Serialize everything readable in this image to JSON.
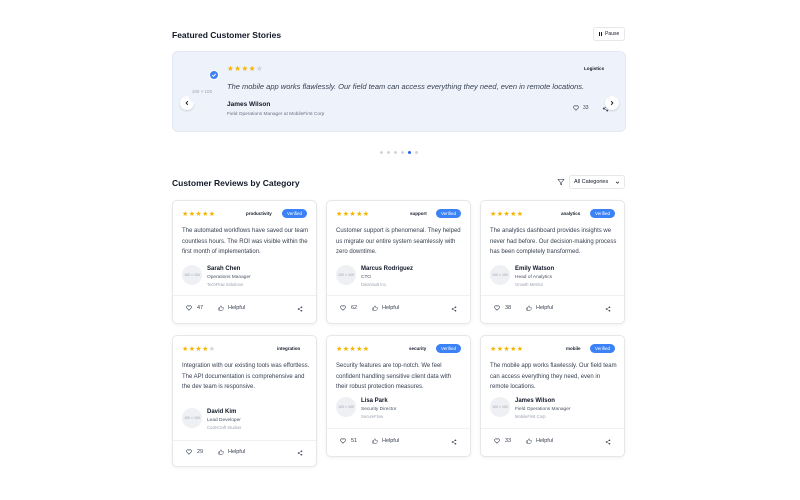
{
  "featured": {
    "section_title": "Featured Customer Stories",
    "pause_label": "Pause",
    "avatar_placeholder": "100 × 100",
    "rating": 4,
    "quote": "The mobile app works flawlessly. Our field team can access everything they need, even in remote locations.",
    "name": "James Wilson",
    "role": "Field Operations Manager at MobileFirst Corp",
    "tag": "Logistics",
    "likes": "33",
    "dots_total": 6,
    "dots_active": 5
  },
  "reviews": {
    "section_title": "Customer Reviews by Category",
    "filter_value": "All Categories",
    "verified_label": "Verified",
    "helpful_label": "Helpful",
    "avatar_placeholder": "100 × 100",
    "colors": {
      "accent": "#3b82f6",
      "star": "#f5b400"
    }
  },
  "cards": [
    {
      "rating": 5,
      "category": "productivity",
      "verified": true,
      "text": "The automated workflows have saved our team countless hours. The ROI was visible within the first month of implementation.",
      "name": "Sarah Chen",
      "role": "Operations Manager",
      "company": "TechFlow Solutions",
      "likes": "47"
    },
    {
      "rating": 5,
      "category": "support",
      "verified": true,
      "text": "Customer support is phenomenal. They helped us migrate our entire system seamlessly with zero downtime.",
      "name": "Marcus Rodriguez",
      "role": "CTO",
      "company": "DataVault Inc.",
      "likes": "62"
    },
    {
      "rating": 5,
      "category": "analytics",
      "verified": true,
      "text": "The analytics dashboard provides insights we never had before. Our decision-making process has been completely transformed.",
      "name": "Emily Watson",
      "role": "Head of Analytics",
      "company": "Growth Metrics",
      "likes": "38"
    },
    {
      "rating": 4,
      "category": "integration",
      "verified": false,
      "text": "Integration with our existing tools was effortless. The API documentation is comprehensive and the dev team is responsive.",
      "name": "David Kim",
      "role": "Lead Developer",
      "company": "CodeCraft Studios",
      "likes": "29"
    },
    {
      "rating": 5,
      "category": "security",
      "verified": true,
      "text": "Security features are top-notch. We feel confident handling sensitive client data with their robust protection measures.",
      "name": "Lisa Park",
      "role": "Security Director",
      "company": "SecureFlow",
      "likes": "51"
    },
    {
      "rating": 5,
      "category": "mobile",
      "verified": true,
      "text": "The mobile app works flawlessly. Our field team can access everything they need, even in remote locations.",
      "name": "James Wilson",
      "role": "Field Operations Manager",
      "company": "MobileFirst Corp",
      "likes": "33"
    }
  ]
}
